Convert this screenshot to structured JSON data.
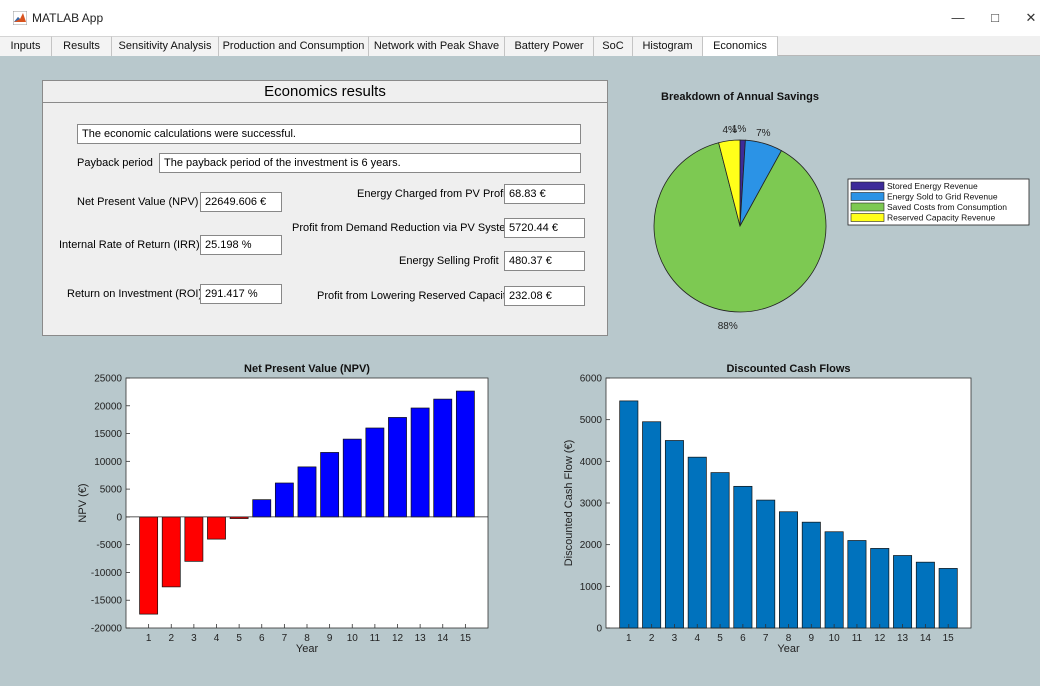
{
  "window": {
    "title": "MATLAB App"
  },
  "tabs": [
    {
      "label": "Inputs"
    },
    {
      "label": "Results"
    },
    {
      "label": "Sensitivity Analysis"
    },
    {
      "label": "Production and Consumption"
    },
    {
      "label": "Network with Peak Shave"
    },
    {
      "label": "Battery Power"
    },
    {
      "label": "SoC"
    },
    {
      "label": "Histogram"
    },
    {
      "label": "Economics"
    }
  ],
  "active_tab": "Economics",
  "panel": {
    "title": "Economics results",
    "status": "The economic calculations were successful.",
    "payback_label": "Payback period",
    "payback_value": "The payback period of the investment is 6 years.",
    "npv_label": "Net Present Value (NPV)",
    "npv_value": "22649.606 €",
    "irr_label": "Internal Rate of Return (IRR)",
    "irr_value": "25.198 %",
    "roi_label": "Return on Investment (ROI)",
    "roi_value": "291.417 %",
    "pv_charged_label": "Energy Charged from PV Profit",
    "pv_charged_value": "68.83 €",
    "demand_label": "Profit from Demand Reduction via PV System",
    "demand_value": "5720.44 €",
    "selling_label": "Energy Selling Profit",
    "selling_value": "480.37 €",
    "reserved_label": "Profit from Lowering Reserved Capacity",
    "reserved_value": "232.08 €"
  },
  "colors": {
    "negative": "#ff0000",
    "positive": "#0000ff",
    "dcf": "#0072bd",
    "pie": [
      "#3d2b99",
      "#2b93e6",
      "#7dc952",
      "#ffff1a"
    ]
  },
  "chart_data": [
    {
      "type": "pie",
      "title": "Breakdown of Annual Savings",
      "labels": [
        "Stored Energy Revenue",
        "Energy Sold to Grid Revenue",
        "Saved Costs from Consumption",
        "Reserved Capacity Revenue"
      ],
      "values": [
        1,
        7,
        88,
        4
      ],
      "slice_labels": [
        "1%",
        "7%",
        "88%",
        "4%"
      ],
      "legend": "right"
    },
    {
      "type": "bar",
      "title": "Net Present Value (NPV)",
      "xlabel": "Year",
      "ylabel": "NPV (€)",
      "categories": [
        "1",
        "2",
        "3",
        "4",
        "5",
        "6",
        "7",
        "8",
        "9",
        "10",
        "11",
        "12",
        "13",
        "14",
        "15"
      ],
      "values": [
        -17500,
        -12600,
        -8000,
        -4000,
        -300,
        3100,
        6100,
        9000,
        11600,
        14000,
        16000,
        17900,
        19600,
        21200,
        22650
      ],
      "ylim": [
        -20000,
        25000
      ],
      "yticks": [
        "25000",
        "20000",
        "15000",
        "10000",
        "5000",
        "0",
        "-5000",
        "-10000",
        "-15000",
        "-20000"
      ]
    },
    {
      "type": "bar",
      "title": "Discounted Cash Flows",
      "xlabel": "Year",
      "ylabel": "Discounted Cash Flow (€)",
      "categories": [
        "1",
        "2",
        "3",
        "4",
        "5",
        "6",
        "7",
        "8",
        "9",
        "10",
        "11",
        "12",
        "13",
        "14",
        "15"
      ],
      "values": [
        5450,
        4950,
        4500,
        4100,
        3730,
        3400,
        3070,
        2790,
        2540,
        2310,
        2100,
        1910,
        1740,
        1580,
        1430
      ],
      "ylim": [
        0,
        6000
      ],
      "yticks": [
        "6000",
        "5000",
        "4000",
        "3000",
        "2000",
        "1000",
        "0"
      ]
    }
  ]
}
